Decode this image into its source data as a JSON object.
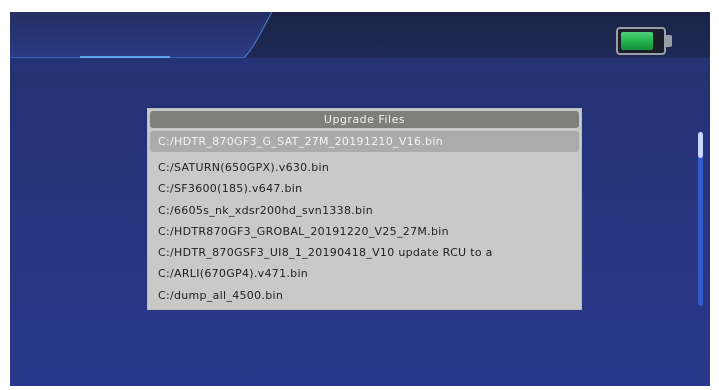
{
  "dialog": {
    "title": "Upgrade Files",
    "files": [
      "C:/HDTR_870GF3_G_SAT_27M_20191210_V16.bin",
      "C:/SATURN(650GPX).v630.bin",
      "C:/SF3600(185).v647.bin",
      "C:/6605s_nk_xdsr200hd_svn1338.bin",
      "C:/HDTR870GF3_GROBAL_20191220_V25_27M.bin",
      "C:/HDTR_870GSF3_UI8_1_20190418_V10 update RCU to a",
      "C:/ARLI(670GP4).v471.bin",
      "C:/dump_all_4500.bin"
    ],
    "selected_index": 0
  },
  "status": {
    "battery_icon": "battery-icon",
    "battery_level": 0.8,
    "battery_color": "#1fae4a"
  },
  "scroll": {
    "position": 0.0
  }
}
